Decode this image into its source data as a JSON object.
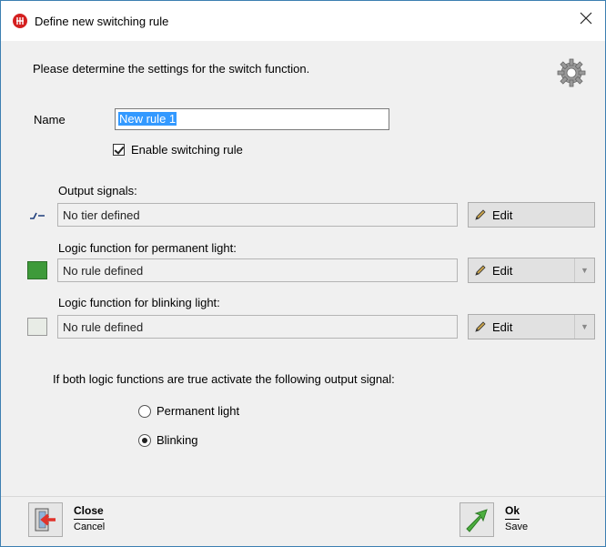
{
  "window": {
    "title": "Define new switching rule",
    "close_symbol": "✕"
  },
  "intro": "Please determine the settings for the switch function.",
  "name": {
    "label": "Name",
    "value": "New rule 1"
  },
  "enable": {
    "label": "Enable switching rule",
    "checked": true
  },
  "sections": {
    "output": {
      "label": "Output signals:",
      "value": "No tier defined",
      "edit_label": "Edit"
    },
    "permanent": {
      "label": "Logic function for permanent light:",
      "value": "No rule defined",
      "edit_label": "Edit",
      "swatch_color": "#3e9a3a"
    },
    "blinking": {
      "label": "Logic function for blinking light:",
      "value": "No rule defined",
      "edit_label": "Edit",
      "swatch_color": "#e8ece6"
    }
  },
  "both_true_label": "If both logic functions are true activate the following output signal:",
  "radios": [
    {
      "label": "Permanent light",
      "selected": false
    },
    {
      "label": "Blinking",
      "selected": true
    }
  ],
  "footer": {
    "close": {
      "main": "Close",
      "sub": "Cancel"
    },
    "ok": {
      "main": "Ok",
      "sub": "Save"
    }
  },
  "icons": [
    "app-logo-icon",
    "gear-icon",
    "signal-icon",
    "pencil-icon",
    "dropdown-arrow-icon",
    "close-door-icon",
    "ok-arrow-icon"
  ]
}
